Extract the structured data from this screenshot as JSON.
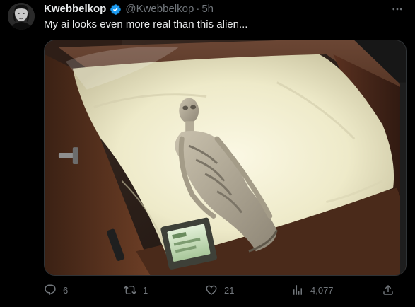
{
  "tweet": {
    "author": {
      "display_name": "Kwebbelkop",
      "handle": "@Kwebbelkop",
      "verified": true,
      "verified_color": "#1d9bf0"
    },
    "separator": "·",
    "time": "5h",
    "text": "My ai looks even more real than this alien...",
    "more_icon": "more-horizontal-icon",
    "image": {
      "alt_description": "photo"
    },
    "actions": {
      "replies": "6",
      "reposts": "1",
      "likes": "21",
      "views": "4,077"
    }
  },
  "colors": {
    "background": "#000000",
    "primary_text": "#e7e9ea",
    "secondary_text": "#71767b",
    "border": "#2f3336"
  }
}
